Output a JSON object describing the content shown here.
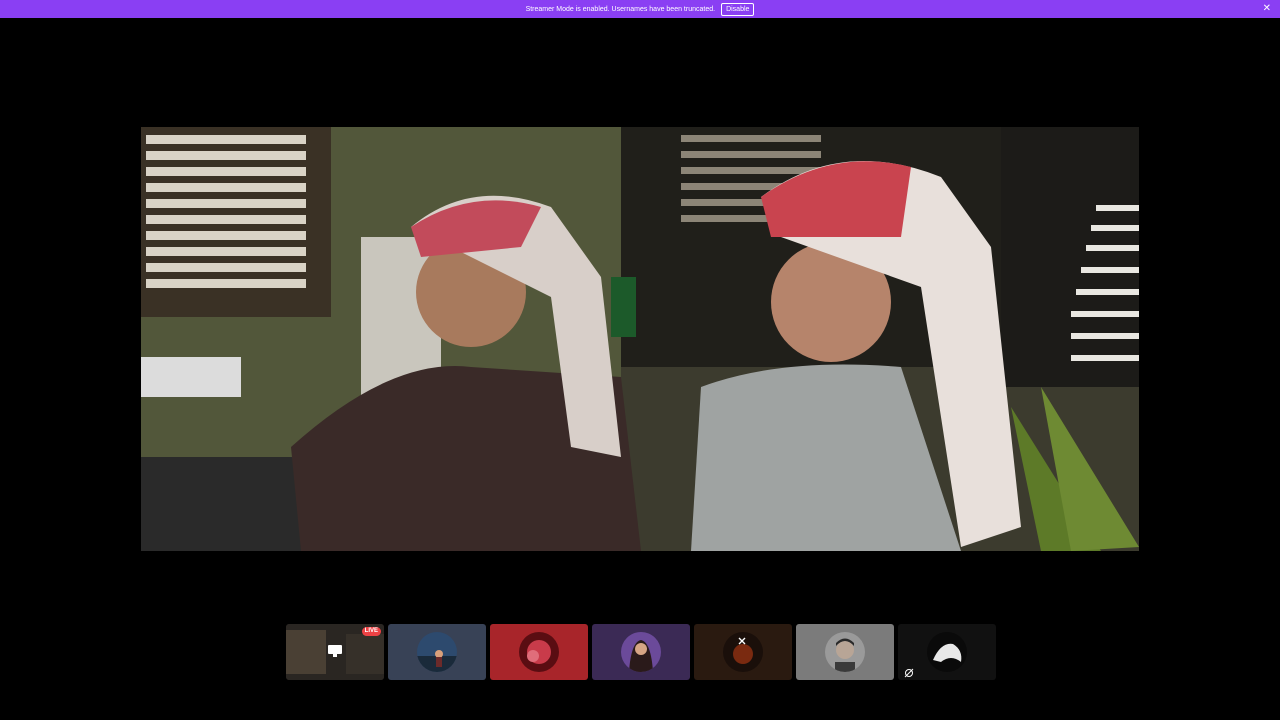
{
  "notice": {
    "message": "Streamer Mode is enabled. Usernames have been truncated.",
    "button_label": "Disable",
    "close_icon": "close-icon",
    "color": "#8a3ff3"
  },
  "stream": {
    "content": "video-frame"
  },
  "participants": [
    {
      "kind": "screen-share",
      "live_label": "LIVE",
      "bg": "#1a1a1a",
      "icon": "monitor-icon"
    },
    {
      "kind": "avatar",
      "bg": "#384256"
    },
    {
      "kind": "avatar",
      "bg": "#a8252a"
    },
    {
      "kind": "avatar",
      "bg": "#3b2a55"
    },
    {
      "kind": "avatar",
      "bg": "#2a1a10",
      "icon": "mute-icon"
    },
    {
      "kind": "avatar",
      "bg": "#7b7b7b"
    },
    {
      "kind": "avatar",
      "bg": "#111111",
      "icon": "deafen-icon"
    }
  ],
  "colors": {
    "live": "#ed4245",
    "background": "#000000"
  }
}
